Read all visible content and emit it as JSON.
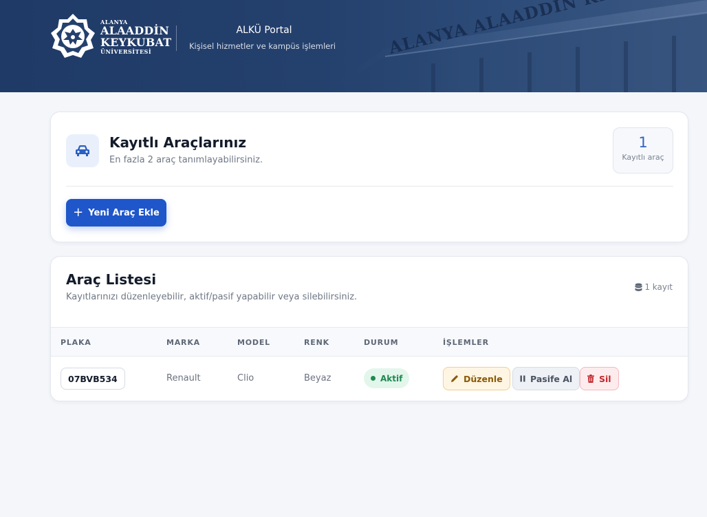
{
  "header": {
    "logo": {
      "small_top": "ALANYA",
      "line1": "ALAADDİN",
      "line2": "KEYKUBAT",
      "small_bottom": "ÜNİVERSİTESİ",
      "building_sign": "ALANYA ALAADDIN KE"
    },
    "portal_title": "ALKÜ Portal",
    "portal_subtitle": "Kişisel hizmetler ve kampüs işlemleri"
  },
  "vehicles_card": {
    "title": "Kayıtlı Araçlarınız",
    "subtitle": "En fazla 2 araç tanımlayabilirsiniz.",
    "count_value": "1",
    "count_label": "Kayıtlı araç",
    "add_button_label": "Yeni Araç Ekle"
  },
  "list_card": {
    "title": "Araç Listesi",
    "subtitle": "Kayıtlarınızı düzenleyebilir, aktif/pasif yapabilir veya silebilirsiniz.",
    "record_count": "1 kayıt",
    "columns": [
      "PLAKA",
      "MARKA",
      "MODEL",
      "RENK",
      "DURUM",
      "İŞLEMLER"
    ],
    "rows": [
      {
        "plate": "07BVB534",
        "brand": "Renault",
        "model": "Clio",
        "color": "Beyaz",
        "status": "Aktif",
        "actions": {
          "edit": "Düzenle",
          "deactivate": "Pasife Al",
          "delete": "Sil"
        }
      }
    ]
  },
  "colors": {
    "header_bg": "#1f3a66",
    "primary": "#1f56c9",
    "status_active": "#1e8a4f",
    "edit": "#8a5a06",
    "delete": "#c1272d"
  },
  "icons": [
    "university-logo",
    "car-icon",
    "plus-icon",
    "database-icon",
    "pencil-icon",
    "pause-icon",
    "trash-icon"
  ]
}
